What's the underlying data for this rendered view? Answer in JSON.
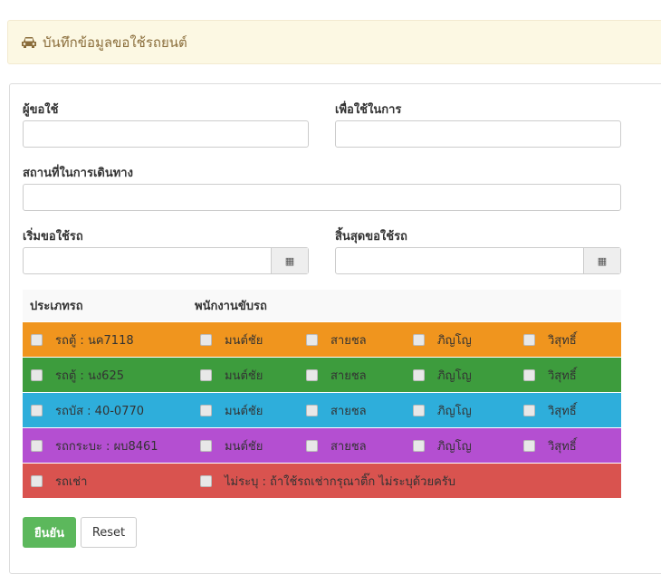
{
  "header": {
    "title": "บันทึกข้อมูลขอใช้รถยนต์",
    "icon": "car-icon"
  },
  "form": {
    "requester_label": "ผู้ขอใช้",
    "requester_value": "",
    "purpose_label": "เพื่อใช้ในการ",
    "purpose_value": "",
    "destination_label": "สถานที่ในการเดินทาง",
    "destination_value": "",
    "start_label": "เริ่มขอใช้รถ",
    "start_value": "",
    "end_label": "สิ้นสุดขอใช้รถ",
    "end_value": ""
  },
  "table": {
    "col_vehicle": "ประเภทรถ",
    "col_driver": "พนักงานขับรถ",
    "rows": [
      {
        "vehicle": "รถตู้ : นค7118",
        "color": "#f0951e",
        "drivers": [
          "มนต์ชัย",
          "สายชล",
          "ภิญโญ",
          "วิสุทธิ์"
        ]
      },
      {
        "vehicle": "รถตู้ : นง625",
        "color": "#3d9c3d",
        "drivers": [
          "มนต์ชัย",
          "สายชล",
          "ภิญโญ",
          "วิสุทธิ์"
        ]
      },
      {
        "vehicle": "รถบัส : 40-0770",
        "color": "#2eaedb",
        "drivers": [
          "มนต์ชัย",
          "สายชล",
          "ภิญโญ",
          "วิสุทธิ์"
        ]
      },
      {
        "vehicle": "รถกระบะ : ผบ8461",
        "color": "#b44fd1",
        "drivers": [
          "มนต์ชัย",
          "สายชล",
          "ภิญโญ",
          "วิสุทธิ์"
        ]
      },
      {
        "vehicle": "รถเช่า",
        "color": "#d9534f",
        "note": "ไม่ระบุ : ถ้าใช้รถเช่ากรุณาติ๊ก ไม่ระบุด้วยครับ"
      }
    ]
  },
  "buttons": {
    "submit": "ยืนยัน",
    "reset": "Reset"
  }
}
